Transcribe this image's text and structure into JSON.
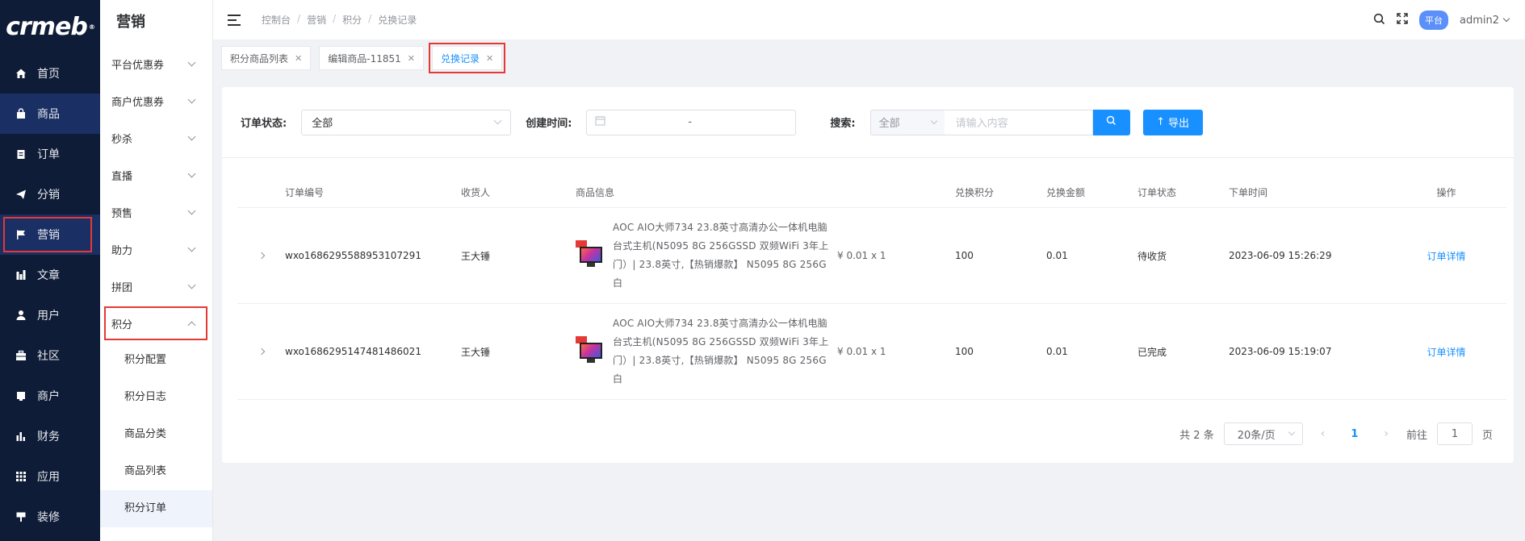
{
  "app": {
    "logo": "crmeb"
  },
  "nav": {
    "items": [
      {
        "label": "首页",
        "icon": "home-icon"
      },
      {
        "label": "商品",
        "icon": "bag-icon"
      },
      {
        "label": "订单",
        "icon": "clipboard-icon"
      },
      {
        "label": "分销",
        "icon": "paper-plane-icon"
      },
      {
        "label": "营销",
        "icon": "flag-icon"
      },
      {
        "label": "文章",
        "icon": "bar-chart-icon"
      },
      {
        "label": "用户",
        "icon": "user-icon"
      },
      {
        "label": "社区",
        "icon": "briefcase-icon"
      },
      {
        "label": "商户",
        "icon": "store-icon"
      },
      {
        "label": "财务",
        "icon": "finance-chart-icon"
      },
      {
        "label": "应用",
        "icon": "grid-icon"
      },
      {
        "label": "装修",
        "icon": "brush-icon"
      }
    ]
  },
  "submenu": {
    "title": "营销",
    "items": [
      {
        "label": "平台优惠券"
      },
      {
        "label": "商户优惠券"
      },
      {
        "label": "秒杀"
      },
      {
        "label": "直播"
      },
      {
        "label": "预售"
      },
      {
        "label": "助力"
      },
      {
        "label": "拼团"
      },
      {
        "label": "积分"
      }
    ],
    "children": [
      {
        "label": "积分配置"
      },
      {
        "label": "积分日志"
      },
      {
        "label": "商品分类"
      },
      {
        "label": "商品列表"
      },
      {
        "label": "积分订单"
      }
    ]
  },
  "header": {
    "breadcrumb": [
      "控制台",
      "营销",
      "积分",
      "兑换记录"
    ],
    "badge": "平台",
    "user": "admin2"
  },
  "tabs": [
    {
      "label": "积分商品列表"
    },
    {
      "label": "编辑商品-11851"
    },
    {
      "label": "兑换记录"
    }
  ],
  "filters": {
    "status_label": "订单状态:",
    "status_value": "全部",
    "time_label": "创建时间:",
    "time_sep": "-",
    "search_label": "搜索:",
    "search_type": "全部",
    "search_placeholder": "请输入内容",
    "export_label": "导出"
  },
  "table": {
    "headers": [
      "订单编号",
      "收货人",
      "商品信息",
      "兑换积分",
      "兑换金额",
      "订单状态",
      "下单时间",
      "操作"
    ],
    "rows": [
      {
        "order_no": "wxo1686295588953107291",
        "receiver": "王大锤",
        "goods": "AOC AIO大师734 23.8英寸高清办公一体机电脑台式主机(N5095 8G 256GSSD 双频WiFi 3年上门）| 23.8英寸,【热销爆款】 N5095 8G 256G 白",
        "price": "¥ 0.01 x 1",
        "points": "100",
        "amount": "0.01",
        "status": "待收货",
        "time": "2023-06-09 15:26:29",
        "action": "订单详情"
      },
      {
        "order_no": "wxo1686295147481486021",
        "receiver": "王大锤",
        "goods": "AOC AIO大师734 23.8英寸高清办公一体机电脑台式主机(N5095 8G 256GSSD 双频WiFi 3年上门）| 23.8英寸,【热销爆款】 N5095 8G 256G 白",
        "price": "¥ 0.01 x 1",
        "points": "100",
        "amount": "0.01",
        "status": "已完成",
        "time": "2023-06-09 15:19:07",
        "action": "订单详情"
      }
    ]
  },
  "pagination": {
    "total": "共 2 条",
    "page_size": "20条/页",
    "current": "1",
    "goto_prefix": "前往",
    "goto_value": "1",
    "goto_suffix": "页"
  }
}
